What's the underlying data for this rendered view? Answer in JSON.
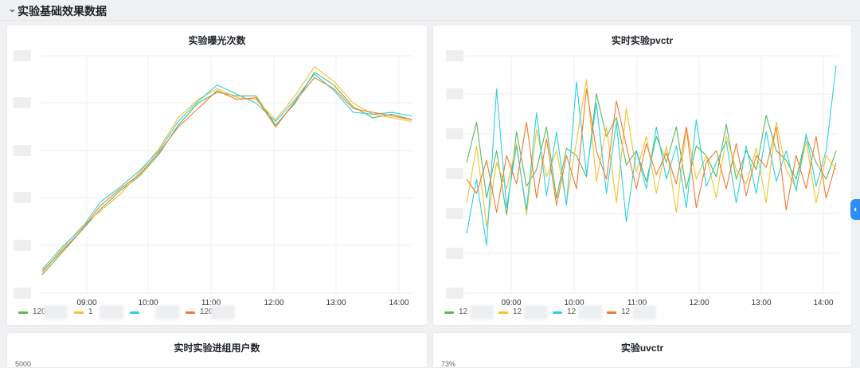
{
  "section": {
    "title": "实验基础效果数据",
    "chevron": "chevron-down-icon"
  },
  "panels": {
    "exposure": {
      "title": "实验曝光次数"
    },
    "pvctr": {
      "title": "实时实验pvctr"
    },
    "group_users": {
      "title": "实时实验进组用户数",
      "y_top_label": "5000"
    },
    "uvctr": {
      "title": "实验uvctr",
      "y_top_label": "73%"
    }
  },
  "colors": {
    "green": "#5bb85d",
    "yellow": "#f5c12e",
    "cyan": "#2cd1e0",
    "orange": "#f27a2e",
    "accent": "#2f8cf7"
  },
  "chart_data": [
    {
      "type": "line",
      "title": "实验曝光次数",
      "x_ticks": [
        "09:00",
        "10:00",
        "11:00",
        "12:00",
        "13:00",
        "14:00"
      ],
      "x": [
        "08:00",
        "08:20",
        "08:40",
        "09:00",
        "09:20",
        "09:40",
        "10:00",
        "10:20",
        "10:40",
        "11:00",
        "11:20",
        "11:40",
        "12:00",
        "12:20",
        "12:40",
        "13:00",
        "13:20",
        "13:40",
        "14:00",
        "14:10"
      ],
      "series": [
        {
          "name": "120",
          "color": "#5bb85d",
          "values": [
            10,
            22,
            34,
            46,
            56,
            64,
            76,
            92,
            104,
            110,
            108,
            108,
            92,
            104,
            121,
            114,
            102,
            96,
            98,
            95
          ]
        },
        {
          "name": "1",
          "color": "#f5c12e",
          "values": [
            11,
            24,
            36,
            45,
            54,
            66,
            79,
            96,
            106,
            112,
            107,
            106,
            95,
            108,
            124,
            116,
            104,
            98,
            96,
            94
          ]
        },
        {
          "name": "",
          "color": "#2cd1e0",
          "values": [
            13,
            25,
            35,
            50,
            58,
            67,
            78,
            94,
            105,
            114,
            109,
            104,
            94,
            106,
            120,
            111,
            99,
            98,
            99,
            97
          ]
        },
        {
          "name": "120",
          "color": "#f27a2e",
          "values": [
            12,
            23,
            34,
            48,
            57,
            65,
            77,
            91,
            101,
            111,
            106,
            107,
            91,
            105,
            118,
            112,
            101,
            99,
            97,
            95
          ]
        }
      ]
    },
    {
      "type": "line",
      "title": "实时实验pvctr",
      "x_ticks": [
        "09:00",
        "10:00",
        "11:00",
        "12:00",
        "13:00",
        "14:00"
      ],
      "x": [
        "08:00",
        "08:10",
        "08:20",
        "08:30",
        "08:40",
        "08:50",
        "09:00",
        "09:10",
        "09:20",
        "09:30",
        "09:40",
        "09:50",
        "10:00",
        "10:10",
        "10:20",
        "10:30",
        "10:40",
        "10:50",
        "11:00",
        "11:10",
        "11:20",
        "11:30",
        "11:40",
        "11:50",
        "12:00",
        "12:10",
        "12:20",
        "12:30",
        "12:40",
        "12:50",
        "13:00",
        "13:10",
        "13:20",
        "13:30",
        "13:40",
        "13:50",
        "14:00",
        "14:10"
      ],
      "series": [
        {
          "name": "12",
          "color": "#5bb85d",
          "values": [
            55,
            72,
            40,
            60,
            33,
            68,
            45,
            52,
            70,
            40,
            61,
            58,
            49,
            84,
            66,
            74,
            54,
            60,
            47,
            66,
            55,
            70,
            44,
            62,
            58,
            49,
            71,
            48,
            60,
            52,
            75,
            60,
            56,
            48,
            66,
            55,
            48,
            60
          ]
        },
        {
          "name": "12",
          "color": "#f5c12e",
          "values": [
            38,
            62,
            28,
            55,
            44,
            63,
            33,
            69,
            49,
            60,
            38,
            64,
            90,
            47,
            70,
            38,
            78,
            51,
            66,
            42,
            62,
            34,
            70,
            48,
            58,
            40,
            66,
            52,
            46,
            61,
            38,
            72,
            52,
            44,
            64,
            38,
            58,
            52
          ]
        },
        {
          "name": "12",
          "color": "#2cd1e0",
          "values": [
            25,
            48,
            20,
            86,
            36,
            62,
            35,
            76,
            41,
            68,
            37,
            89,
            50,
            80,
            42,
            72,
            30,
            60,
            44,
            70,
            48,
            62,
            36,
            73,
            45,
            55,
            64,
            38,
            62,
            42,
            68,
            47,
            60,
            43,
            67,
            45,
            60,
            96
          ]
        },
        {
          "name": "12",
          "color": "#f27a2e",
          "values": [
            48,
            42,
            56,
            34,
            58,
            46,
            72,
            40,
            65,
            37,
            58,
            44,
            86,
            60,
            48,
            81,
            62,
            44,
            63,
            50,
            59,
            46,
            70,
            36,
            55,
            60,
            44,
            63,
            41,
            58,
            53,
            70,
            35,
            58,
            44,
            66,
            40,
            55
          ]
        }
      ]
    }
  ]
}
